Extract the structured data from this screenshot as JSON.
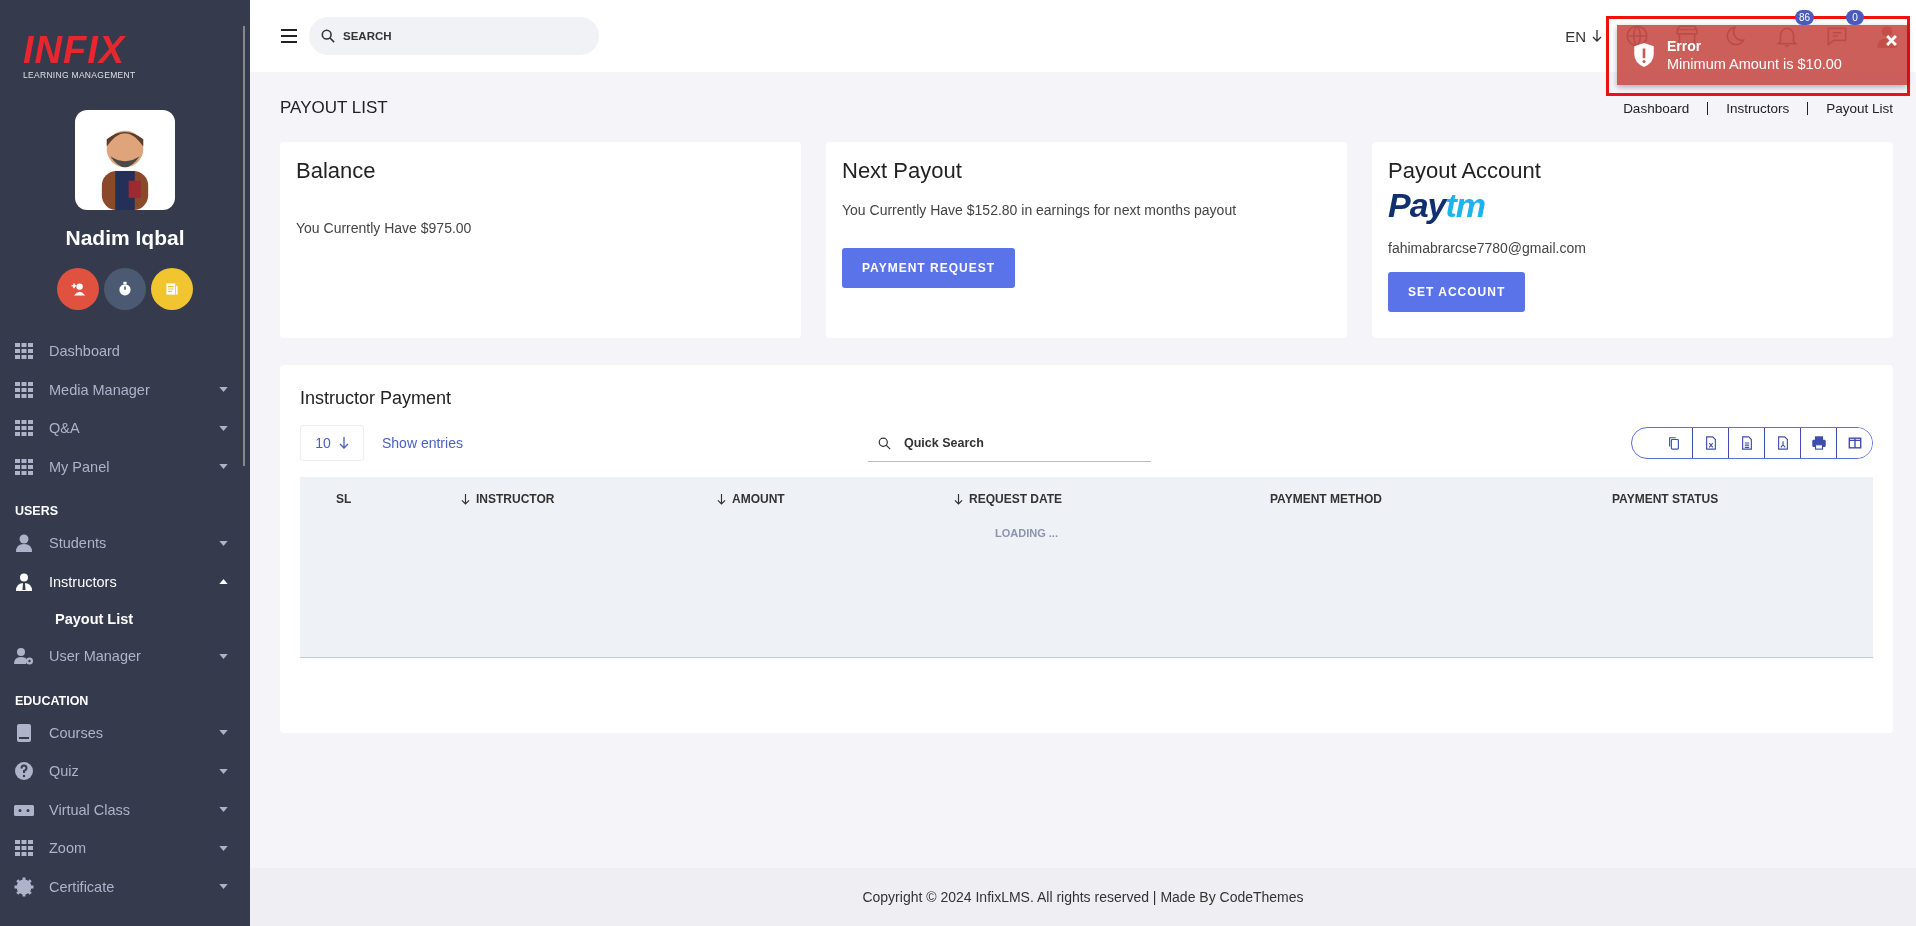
{
  "sidebar": {
    "logo": {
      "brand": "INFIX",
      "tagline": "LEARNING MANAGEMENT"
    },
    "user_name": "Nadim Iqbal",
    "quick_buttons": [
      {
        "color": "#e0523f"
      },
      {
        "color": "#4b5a72"
      },
      {
        "color": "#f0c530"
      }
    ],
    "items": [
      {
        "kind": "item",
        "label": "Dashboard",
        "active": false
      },
      {
        "kind": "item",
        "label": "Media Manager",
        "active": false,
        "expanded": false
      },
      {
        "kind": "item",
        "label": "Q&A",
        "active": false,
        "expanded": false
      },
      {
        "kind": "item",
        "label": "My Panel",
        "active": false,
        "expanded": false
      },
      {
        "kind": "heading",
        "label": "USERS"
      },
      {
        "kind": "item",
        "label": "Students",
        "active": false,
        "expanded": false
      },
      {
        "kind": "item",
        "label": "Instructors",
        "active": true,
        "expanded": true,
        "children": [
          {
            "label": "Payout List",
            "selected": true
          }
        ]
      },
      {
        "kind": "item",
        "label": "User Manager",
        "active": false,
        "expanded": false
      },
      {
        "kind": "heading",
        "label": "EDUCATION"
      },
      {
        "kind": "item",
        "label": "Courses",
        "active": false,
        "expanded": false
      },
      {
        "kind": "item",
        "label": "Quiz",
        "active": false,
        "expanded": false
      },
      {
        "kind": "item",
        "label": "Virtual Class",
        "active": false,
        "expanded": false
      },
      {
        "kind": "item",
        "label": "Zoom",
        "active": false,
        "expanded": false
      },
      {
        "kind": "item",
        "label": "Certificate",
        "active": false,
        "expanded": false
      }
    ]
  },
  "header": {
    "search": {
      "placeholder": "SEARCH"
    },
    "language": "EN",
    "notification_count": "86",
    "message_count": "0"
  },
  "toast": {
    "title": "Error",
    "message": "Minimum Amount is $10.00",
    "highlighted": true
  },
  "page": {
    "title": "PAYOUT LIST",
    "breadcrumb": [
      "Dashboard",
      "Instructors",
      "Payout List"
    ]
  },
  "cards": [
    {
      "kind": "balance",
      "title": "Balance",
      "text": "You Currently Have $975.00"
    },
    {
      "kind": "payout",
      "title": "Next Payout",
      "text": "You Currently Have $152.80 in earnings for next months payout",
      "button": "PAYMENT REQUEST"
    },
    {
      "kind": "account",
      "title": "Payout Account",
      "logo": [
        "Pay",
        "tm"
      ],
      "text": "fahimabrarcse7780@gmail.com",
      "button": "SET ACCOUNT"
    }
  ],
  "table": {
    "title": "Instructor Payment",
    "page_size": "10",
    "show_entries": "Show entries",
    "search": {
      "placeholder": "Quick Search"
    },
    "columns": [
      {
        "label": "SL",
        "sortable": false
      },
      {
        "label": "INSTRUCTOR",
        "sortable": true
      },
      {
        "label": "AMOUNT",
        "sortable": true
      },
      {
        "label": "REQUEST DATE",
        "sortable": true
      },
      {
        "label": "PAYMENT METHOD",
        "sortable": false
      },
      {
        "label": "PAYMENT STATUS",
        "sortable": false
      }
    ],
    "loading": "LOADING ..."
  },
  "footer": "Copyright © 2024 InfixLMS. All rights reserved | Made By CodeThemes"
}
